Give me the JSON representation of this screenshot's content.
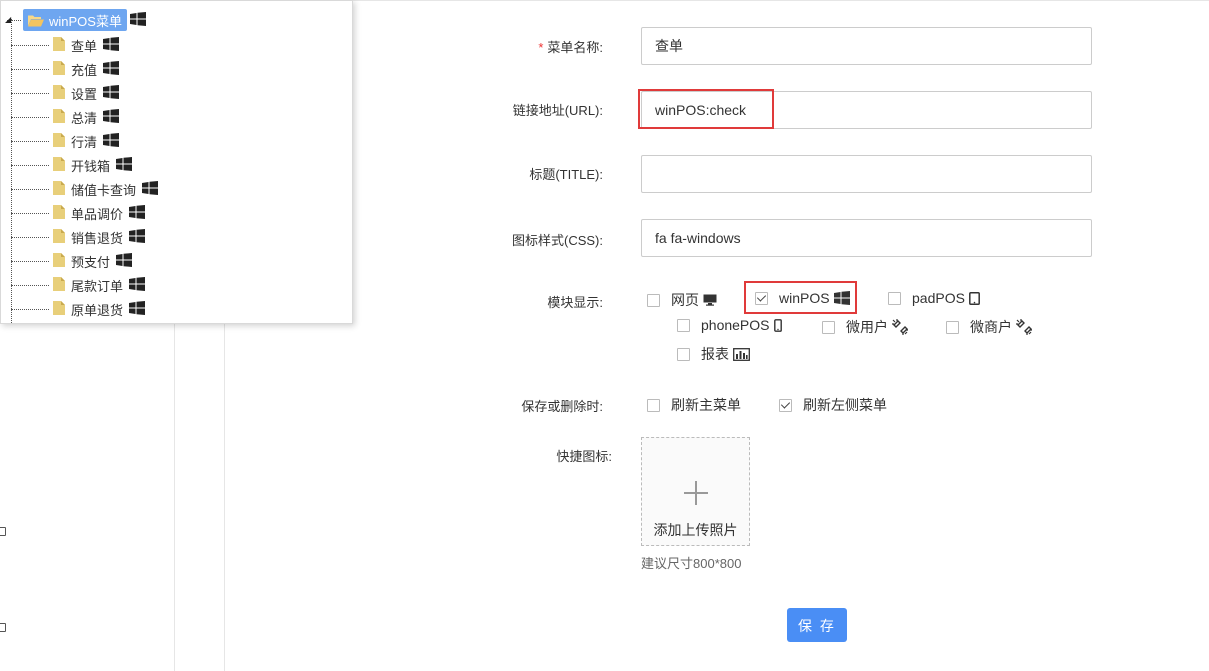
{
  "tree": {
    "root_label": "winPOS菜单",
    "items": [
      {
        "label": "查单"
      },
      {
        "label": "充值"
      },
      {
        "label": "设置"
      },
      {
        "label": "总清"
      },
      {
        "label": "行清"
      },
      {
        "label": "开钱箱"
      },
      {
        "label": "储值卡查询"
      },
      {
        "label": "单品调价"
      },
      {
        "label": "销售退货"
      },
      {
        "label": "预支付"
      },
      {
        "label": "尾款订单"
      },
      {
        "label": "原单退货"
      }
    ]
  },
  "form": {
    "menu_name": {
      "label": "菜单名称:",
      "required_mark": "*",
      "value": "查单"
    },
    "url": {
      "label": "链接地址(URL):",
      "value": "winPOS:check"
    },
    "title": {
      "label": "标题(TITLE):",
      "value": ""
    },
    "css": {
      "label": "图标样式(CSS):",
      "value": "fa fa-windows"
    },
    "modules": {
      "label": "模块显示:",
      "options": [
        {
          "label": "网页",
          "checked": false,
          "icon": "desktop-icon"
        },
        {
          "label": "winPOS",
          "checked": true,
          "icon": "windows-icon"
        },
        {
          "label": "padPOS",
          "checked": false,
          "icon": "tablet-icon"
        },
        {
          "label": "phonePOS",
          "checked": false,
          "icon": "mobile-icon"
        },
        {
          "label": "微用户",
          "checked": false,
          "icon": "broken-link-icon"
        },
        {
          "label": "微商户",
          "checked": false,
          "icon": "broken-link-icon"
        },
        {
          "label": "报表",
          "checked": false,
          "icon": "bar-chart-icon"
        }
      ]
    },
    "on_save": {
      "label": "保存或删除时:",
      "options": [
        {
          "label": "刷新主菜单",
          "checked": false
        },
        {
          "label": "刷新左侧菜单",
          "checked": true
        }
      ]
    },
    "shortcut_icon": {
      "label": "快捷图标:",
      "upload_label": "添加上传照片",
      "hint": "建议尺寸800*800"
    },
    "save_button": "保 存"
  },
  "colors": {
    "accent": "#4a8ef5",
    "tree_selected": "#6ea6f0",
    "highlight": "#e03a3a",
    "required": "#e33333"
  }
}
